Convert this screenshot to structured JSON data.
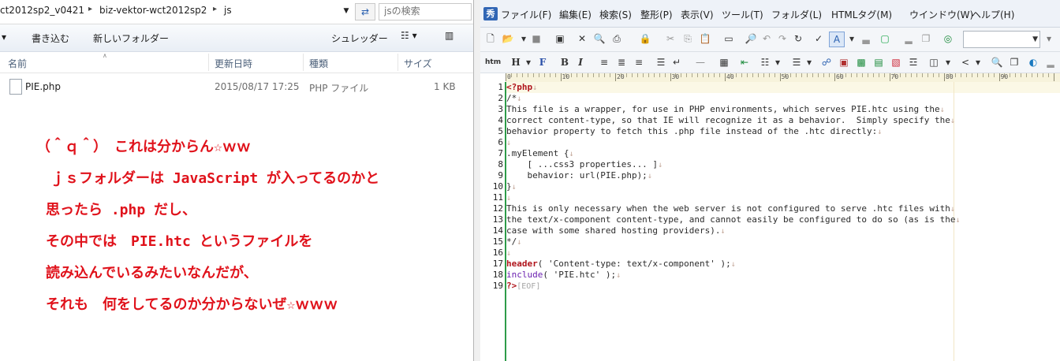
{
  "explorer": {
    "breadcrumbs": [
      "ct2012sp2_v0421",
      "biz-vektor-wct2012sp2",
      "js"
    ],
    "search_placeholder": "jsの検索",
    "toolbar": {
      "share_label": "書き込む",
      "new_folder_label": "新しいフォルダー",
      "shredder_label": "シュレッダー"
    },
    "columns": [
      "名前",
      "更新日時",
      "種類",
      "サイズ"
    ],
    "file": {
      "name": "PIE.php",
      "modified": "2015/08/17 17:25",
      "type": "PHP ファイル",
      "size": "1 KB"
    },
    "annotation_lines": [
      "（＾ｑ＾）　これは分からん☆ｗｗ",
      "ｊｓフォルダーは JavaScript が入ってるのかと",
      "思ったら .php だし、",
      "その中では　PIE.htc というファイルを",
      "読み込んでいるみたいなんだが、",
      "それも　何をしてるのか分からないぜ☆ｗｗｗ"
    ]
  },
  "editor": {
    "app_icon": "秀",
    "menus": [
      "ファイル(F)",
      "編集(E)",
      "検索(S)",
      "整形(P)",
      "表示(V)",
      "ツール(T)",
      "フォルダ(L)",
      "HTMLタグ(M)",
      "ウインドウ(W)",
      "ヘルプ(H)"
    ],
    "toolbar2_labels": {
      "htm": "htm",
      "heading": "H",
      "font": "F",
      "bold": "B",
      "italic": "I"
    },
    "ruler_labels": [
      "0",
      "10",
      "20",
      "30",
      "40",
      "50",
      "60",
      "70",
      "80",
      "90"
    ],
    "line_numbers": [
      "1",
      "2",
      "3",
      "4",
      "5",
      "6",
      "7",
      "8",
      "9",
      "10",
      "11",
      "12",
      "13",
      "14",
      "15",
      "16",
      "17",
      "18",
      "19"
    ],
    "lines": [
      "<?php",
      "/*",
      "This file is a wrapper, for use in PHP environments, which serves PIE.htc using the",
      "correct content-type, so that IE will recognize it as a behavior.  Simply specify the",
      "behavior property to fetch this .php file instead of the .htc directly:",
      "",
      ".myElement {",
      "    [ ...css3 properties... ]",
      "    behavior: url(PIE.php);",
      "}",
      "",
      "This is only necessary when the web server is not configured to serve .htc files with",
      "the text/x-component content-type, and cannot easily be configured to do so (as is the",
      "case with some shared hosting providers).",
      "*/",
      "",
      "header( 'Content-type: text/x-component' );",
      "include( 'PIE.htc' );",
      "?>"
    ],
    "line_end_marker": "↓",
    "eof_marker": "[EOF]",
    "colors": {
      "keyword": "#b0141b",
      "include": "#6a1fb0",
      "gutter_line": "#2e9b49",
      "annotation": "#e0121b"
    }
  }
}
